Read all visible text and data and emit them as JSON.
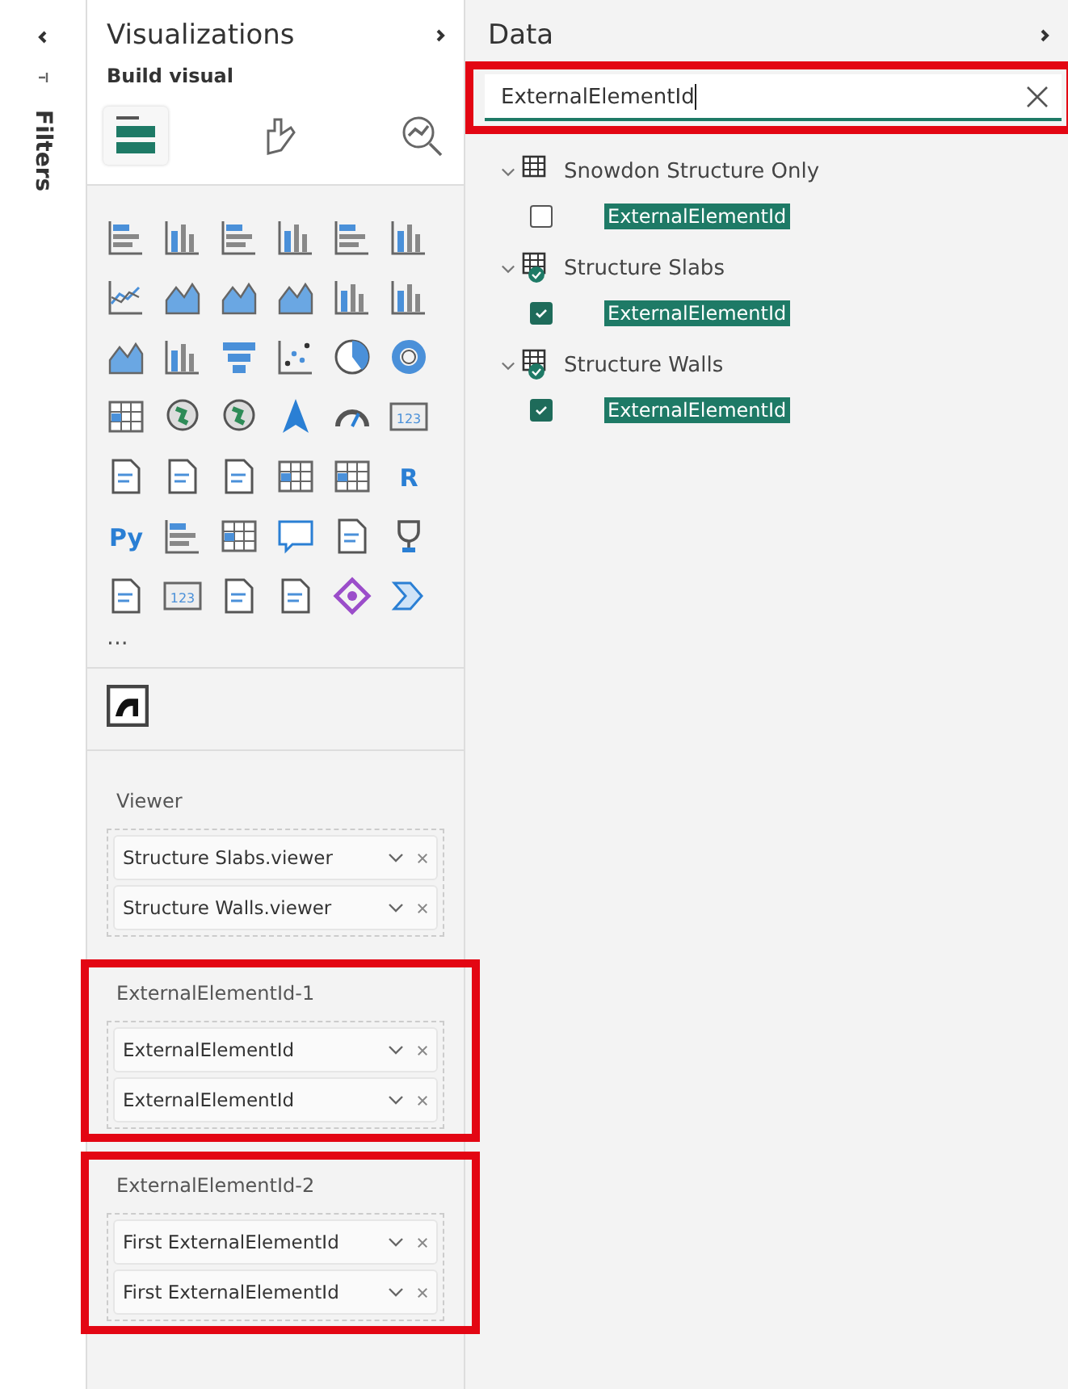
{
  "filters_strip": {
    "title": "Filters"
  },
  "visualizations": {
    "title": "Visualizations",
    "subtitle": "Build visual",
    "tabs": [
      {
        "kind": "fields",
        "selected": true
      },
      {
        "kind": "format",
        "selected": false
      },
      {
        "kind": "analytics",
        "selected": false
      }
    ],
    "visual_icons": [
      {
        "kind": "hbar"
      },
      {
        "kind": "vbar"
      },
      {
        "kind": "hbar"
      },
      {
        "kind": "vbar"
      },
      {
        "kind": "hbar"
      },
      {
        "kind": "vbar"
      },
      {
        "kind": "line"
      },
      {
        "kind": "area"
      },
      {
        "kind": "area"
      },
      {
        "kind": "area"
      },
      {
        "kind": "vbar"
      },
      {
        "kind": "vbar"
      },
      {
        "kind": "area"
      },
      {
        "kind": "vbar"
      },
      {
        "kind": "funnel"
      },
      {
        "kind": "scatter"
      },
      {
        "kind": "pie"
      },
      {
        "kind": "donut"
      },
      {
        "kind": "table"
      },
      {
        "kind": "globe"
      },
      {
        "kind": "globe"
      },
      {
        "kind": "arrow"
      },
      {
        "kind": "gauge"
      },
      {
        "kind": "card",
        "label": "123"
      },
      {
        "kind": "doc"
      },
      {
        "kind": "doc"
      },
      {
        "kind": "doc"
      },
      {
        "kind": "table"
      },
      {
        "kind": "table"
      },
      {
        "kind": "text",
        "label": "R"
      },
      {
        "kind": "text",
        "label": "Py"
      },
      {
        "kind": "hbar"
      },
      {
        "kind": "table"
      },
      {
        "kind": "speech"
      },
      {
        "kind": "doc"
      },
      {
        "kind": "trophy"
      },
      {
        "kind": "doc"
      },
      {
        "kind": "card",
        "label": "123"
      },
      {
        "kind": "doc"
      },
      {
        "kind": "doc"
      },
      {
        "kind": "diamond"
      },
      {
        "kind": "chevron"
      }
    ],
    "more": "...",
    "wells": [
      {
        "title": "Viewer",
        "highlighted": false,
        "fields": [
          "Structure Slabs.viewer",
          "Structure Walls.viewer"
        ]
      },
      {
        "title": "ExternalElementId-1",
        "highlighted": true,
        "fields": [
          "ExternalElementId",
          "ExternalElementId"
        ]
      },
      {
        "title": "ExternalElementId-2",
        "highlighted": true,
        "fields": [
          "First ExternalElementId",
          "First ExternalElementId"
        ]
      }
    ]
  },
  "data": {
    "title": "Data",
    "search": {
      "value": "ExternalElementId",
      "highlighted": true
    },
    "tables": [
      {
        "name": "Snowdon Structure Only",
        "expanded": true,
        "in_use": false,
        "fields": [
          {
            "name": "ExternalElementId",
            "checked": false
          }
        ]
      },
      {
        "name": "Structure Slabs",
        "expanded": true,
        "in_use": true,
        "fields": [
          {
            "name": "ExternalElementId",
            "checked": true
          }
        ]
      },
      {
        "name": "Structure Walls",
        "expanded": true,
        "in_use": true,
        "fields": [
          {
            "name": "ExternalElementId",
            "checked": true
          }
        ]
      }
    ]
  }
}
